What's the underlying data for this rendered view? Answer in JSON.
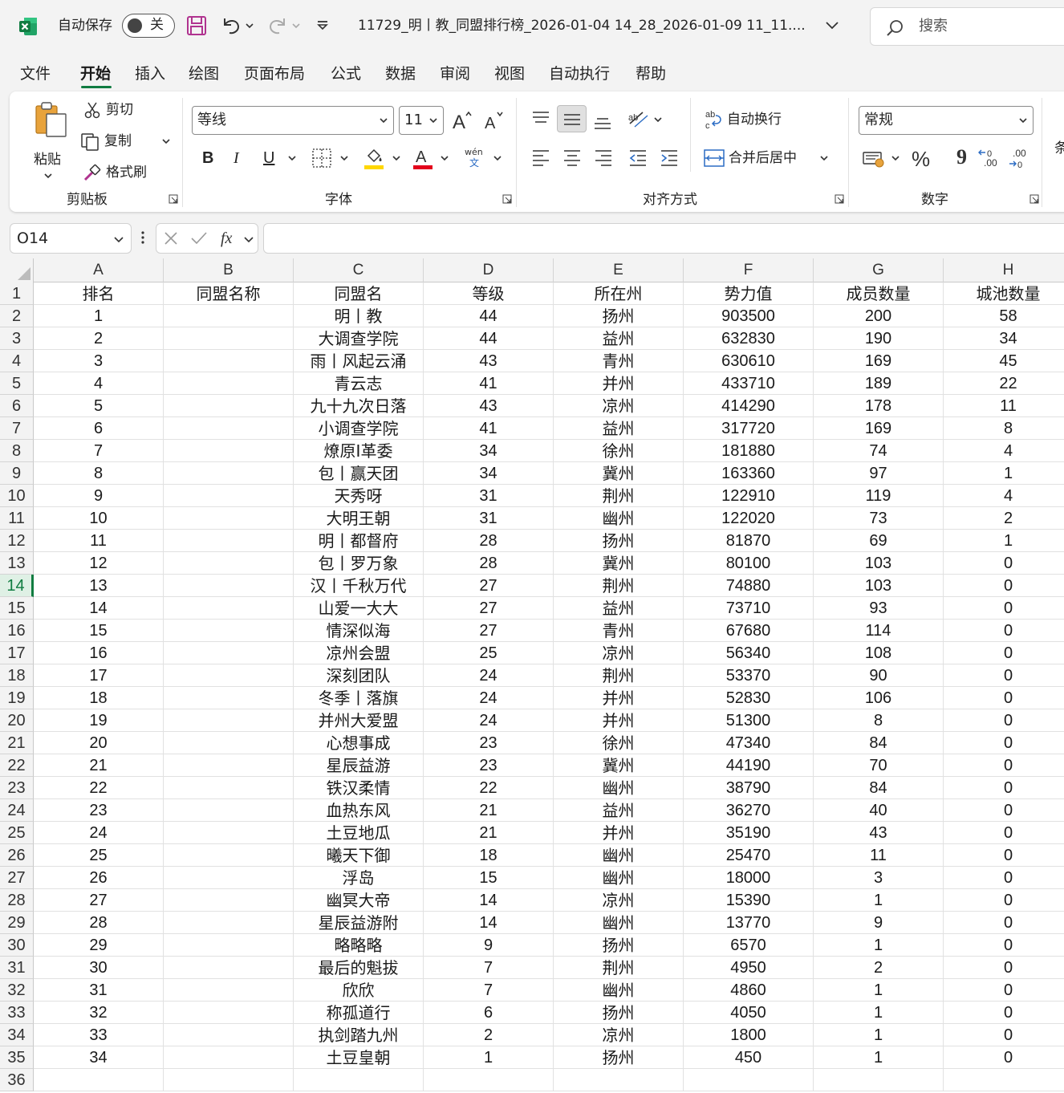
{
  "titlebar": {
    "autosave_label": "自动保存",
    "autosave_state": "关",
    "document_title": "11729_明丨教_同盟排行榜_2026-01-04 14_28_2026-01-09 11_11....",
    "search_placeholder": "搜索",
    "icons": [
      "excel-logo-icon",
      "save-icon",
      "undo-icon",
      "redo-icon",
      "customize-qat-icon",
      "chevron-down-icon",
      "search-icon"
    ]
  },
  "menu": {
    "tabs": [
      "文件",
      "开始",
      "插入",
      "绘图",
      "页面布局",
      "公式",
      "数据",
      "审阅",
      "视图",
      "自动执行",
      "帮助"
    ],
    "active": "开始"
  },
  "ribbon": {
    "clipboard": {
      "paste": "粘贴",
      "cut": "剪切",
      "copy": "复制",
      "format_painter": "格式刷",
      "label": "剪贴板"
    },
    "font": {
      "font_name": "等线",
      "font_size": "11",
      "bold": "B",
      "italic": "I",
      "underline": "U",
      "phonetic_top": "wén",
      "phonetic_bottom": "文",
      "label": "字体",
      "fill_color": "#ffd700",
      "font_color": "#e3001b"
    },
    "alignment": {
      "wrap_text": "自动换行",
      "merge_center": "合并后居中",
      "label": "对齐方式"
    },
    "number": {
      "format": "常规",
      "percent": "%",
      "comma": "9",
      "increase_decimal": ".00",
      "decrease_decimal": ".00",
      "label": "数字",
      "partial_next_group": "条"
    }
  },
  "formula_bar": {
    "name_box": "O14",
    "fx": "fx",
    "formula": ""
  },
  "sheet": {
    "columns": [
      "A",
      "B",
      "C",
      "D",
      "E",
      "F",
      "G",
      "H"
    ],
    "selected_row": "14",
    "accent": "#107c41",
    "rows": [
      [
        "1",
        "排名",
        "同盟名称",
        "同盟名",
        "等级",
        "所在州",
        "势力值",
        "成员数量",
        "城池数量"
      ],
      [
        "2",
        "1",
        "",
        "明丨教",
        "44",
        "扬州",
        "903500",
        "200",
        "58"
      ],
      [
        "3",
        "2",
        "",
        "大调查学院",
        "44",
        "益州",
        "632830",
        "190",
        "34"
      ],
      [
        "4",
        "3",
        "",
        "雨丨风起云涌",
        "43",
        "青州",
        "630610",
        "169",
        "45"
      ],
      [
        "5",
        "4",
        "",
        "青云志",
        "41",
        "并州",
        "433710",
        "189",
        "22"
      ],
      [
        "6",
        "5",
        "",
        "九十九次日落",
        "43",
        "凉州",
        "414290",
        "178",
        "11"
      ],
      [
        "7",
        "6",
        "",
        "小调查学院",
        "41",
        "益州",
        "317720",
        "169",
        "8"
      ],
      [
        "8",
        "7",
        "",
        "燎原I革委",
        "34",
        "徐州",
        "181880",
        "74",
        "4"
      ],
      [
        "9",
        "8",
        "",
        "包丨赢天团",
        "34",
        "冀州",
        "163360",
        "97",
        "1"
      ],
      [
        "10",
        "9",
        "",
        "天秀呀",
        "31",
        "荆州",
        "122910",
        "119",
        "4"
      ],
      [
        "11",
        "10",
        "",
        "大明王朝",
        "31",
        "幽州",
        "122020",
        "73",
        "2"
      ],
      [
        "12",
        "11",
        "",
        "明丨都督府",
        "28",
        "扬州",
        "81870",
        "69",
        "1"
      ],
      [
        "13",
        "12",
        "",
        "包丨罗万象",
        "28",
        "冀州",
        "80100",
        "103",
        "0"
      ],
      [
        "14",
        "13",
        "",
        "汉丨千秋万代",
        "27",
        "荆州",
        "74880",
        "103",
        "0"
      ],
      [
        "15",
        "14",
        "",
        "山爱一大大",
        "27",
        "益州",
        "73710",
        "93",
        "0"
      ],
      [
        "16",
        "15",
        "",
        "情深似海",
        "27",
        "青州",
        "67680",
        "114",
        "0"
      ],
      [
        "17",
        "16",
        "",
        "凉州会盟",
        "25",
        "凉州",
        "56340",
        "108",
        "0"
      ],
      [
        "18",
        "17",
        "",
        "深刻团队",
        "24",
        "荆州",
        "53370",
        "90",
        "0"
      ],
      [
        "19",
        "18",
        "",
        "冬季丨落旗",
        "24",
        "并州",
        "52830",
        "106",
        "0"
      ],
      [
        "20",
        "19",
        "",
        "并州大爱盟",
        "24",
        "并州",
        "51300",
        "8",
        "0"
      ],
      [
        "21",
        "20",
        "",
        "心想事成",
        "23",
        "徐州",
        "47340",
        "84",
        "0"
      ],
      [
        "22",
        "21",
        "",
        "星辰益游",
        "23",
        "冀州",
        "44190",
        "70",
        "0"
      ],
      [
        "23",
        "22",
        "",
        "铁汉柔情",
        "22",
        "幽州",
        "38790",
        "84",
        "0"
      ],
      [
        "24",
        "23",
        "",
        "血热东风",
        "21",
        "益州",
        "36270",
        "40",
        "0"
      ],
      [
        "25",
        "24",
        "",
        "土豆地瓜",
        "21",
        "并州",
        "35190",
        "43",
        "0"
      ],
      [
        "26",
        "25",
        "",
        "曦天下御",
        "18",
        "幽州",
        "25470",
        "11",
        "0"
      ],
      [
        "27",
        "26",
        "",
        "浮岛",
        "15",
        "幽州",
        "18000",
        "3",
        "0"
      ],
      [
        "28",
        "27",
        "",
        "幽冥大帝",
        "14",
        "凉州",
        "15390",
        "1",
        "0"
      ],
      [
        "29",
        "28",
        "",
        "星辰益游附",
        "14",
        "幽州",
        "13770",
        "9",
        "0"
      ],
      [
        "30",
        "29",
        "",
        "略略略",
        "9",
        "扬州",
        "6570",
        "1",
        "0"
      ],
      [
        "31",
        "30",
        "",
        "最后的魁拔",
        "7",
        "荆州",
        "4950",
        "2",
        "0"
      ],
      [
        "32",
        "31",
        "",
        "欣欣",
        "7",
        "幽州",
        "4860",
        "1",
        "0"
      ],
      [
        "33",
        "32",
        "",
        "称孤道行",
        "6",
        "扬州",
        "4050",
        "1",
        "0"
      ],
      [
        "34",
        "33",
        "",
        "执剑踏九州",
        "2",
        "凉州",
        "1800",
        "1",
        "0"
      ],
      [
        "35",
        "34",
        "",
        "土豆皇朝",
        "1",
        "扬州",
        "450",
        "1",
        "0"
      ],
      [
        "36",
        "",
        "",
        "",
        "",
        "",
        "",
        "",
        ""
      ]
    ]
  }
}
